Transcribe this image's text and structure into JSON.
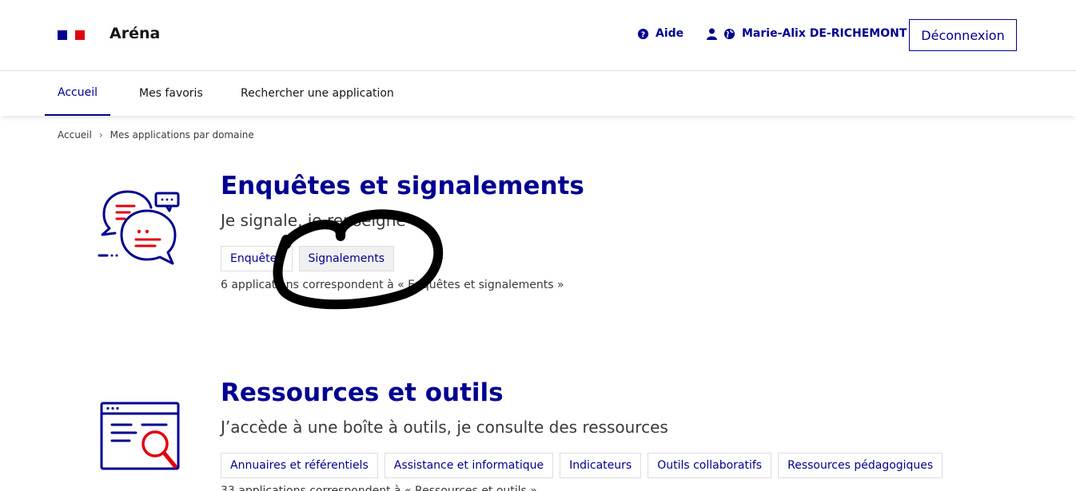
{
  "header": {
    "app_name": "Aréna",
    "help_label": "Aide",
    "user_name": "Marie-Alix DE-RICHEMONT",
    "logout_label": "Déconnexion"
  },
  "nav": {
    "items": [
      {
        "label": "Accueil",
        "active": true
      },
      {
        "label": "Mes favoris",
        "active": false
      },
      {
        "label": "Rechercher une application",
        "active": false
      }
    ]
  },
  "breadcrumb": {
    "items": [
      "Accueil",
      "Mes applications par domaine"
    ]
  },
  "domains": [
    {
      "title": "Enquêtes et signalements",
      "subtitle": "Je signale, je renseigne",
      "tags": [
        "Enquêtes",
        "Signalements"
      ],
      "count_text": "6 applications correspondent à « Enquêtes et signalements »",
      "icon": "speech-bubbles-icon"
    },
    {
      "title": "Ressources et outils",
      "subtitle": "J’accède à une boîte à outils, je consulte des ressources",
      "tags": [
        "Annuaires et référentiels",
        "Assistance et informatique",
        "Indicateurs",
        "Outils collaboratifs",
        "Ressources pédagogiques"
      ],
      "count_text": "33 applications correspondent à « Ressources et outils »",
      "icon": "window-magnifier-icon"
    }
  ],
  "colors": {
    "primary": "#000091",
    "accent_red": "#e1000f",
    "text": "#161616",
    "border": "#dddddd"
  }
}
